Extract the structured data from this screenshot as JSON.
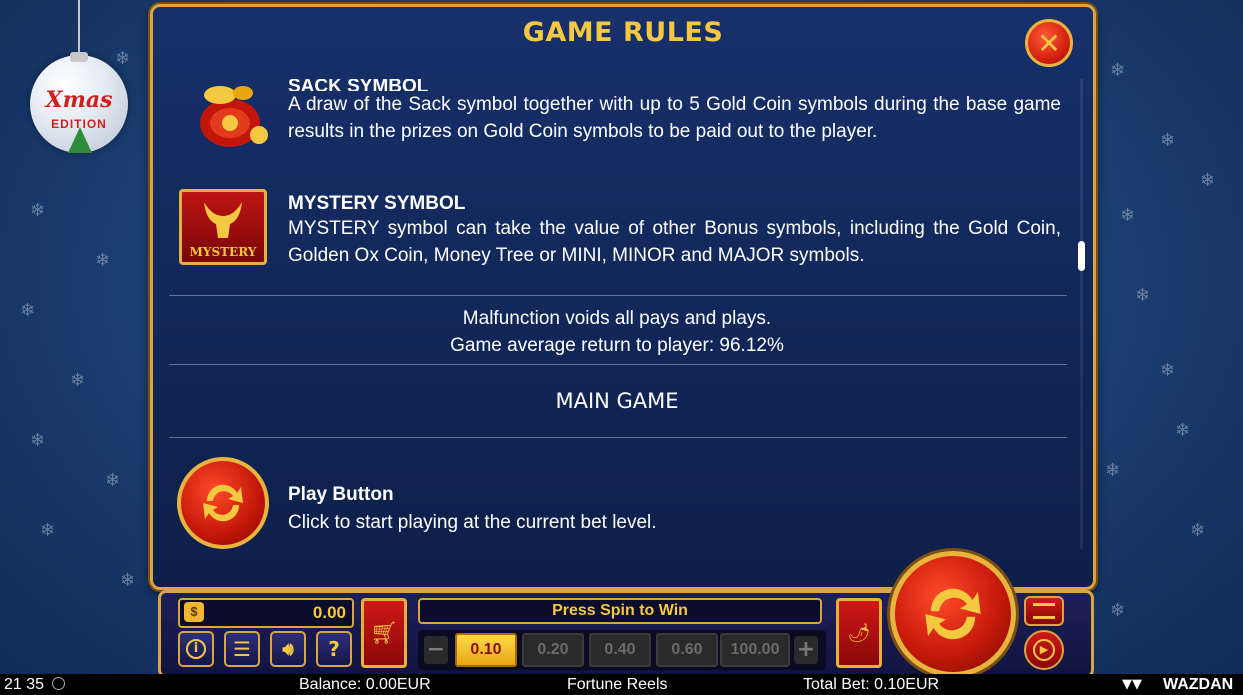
{
  "ornament": {
    "line1": "Xmas",
    "line2": "EDITION"
  },
  "rules_panel": {
    "title": "GAME RULES",
    "close_label": "✕",
    "sack": {
      "title": "SACK SYMBOL",
      "description": "A draw of the Sack symbol together with up to 5 Gold Coin symbols during the base game results in the prizes on Gold Coin symbols to be paid out to the player."
    },
    "mystery": {
      "icon_label": "MYSTERY",
      "title": "MYSTERY SYMBOL",
      "description": "MYSTERY symbol can take the value of other Bonus symbols, including the Gold Coin, Golden Ox Coin, Money Tree or MINI, MINOR and MAJOR symbols."
    },
    "notice_line1": "Malfunction voids all pays and plays.",
    "notice_line2": "Game average return to player: 96.12%",
    "section_heading": "MAIN GAME",
    "play_button": {
      "title": "Play Button",
      "description": "Click to start playing at the current bet level."
    }
  },
  "controls": {
    "balance_value": "0.00",
    "message": "Press Spin to Win",
    "bet_options": [
      "0.10",
      "0.20",
      "0.40",
      "0.60",
      "100.00"
    ],
    "selected_bet": "0.10",
    "minus": "−",
    "plus": "+",
    "info_icon": "info-icon",
    "menu_icon": "menu-icon",
    "sound_icon": "sound-icon",
    "help_label": "?"
  },
  "status_bar": {
    "time": "21 35",
    "balance": "Balance: 0.00EUR",
    "game_name": "Fortune Reels",
    "total_bet": "Total Bet: 0.10EUR",
    "brand": "WAZDAN"
  },
  "colors": {
    "gold": "#f5c842",
    "panel_blue": "#112657",
    "red": "#c81a0a"
  }
}
